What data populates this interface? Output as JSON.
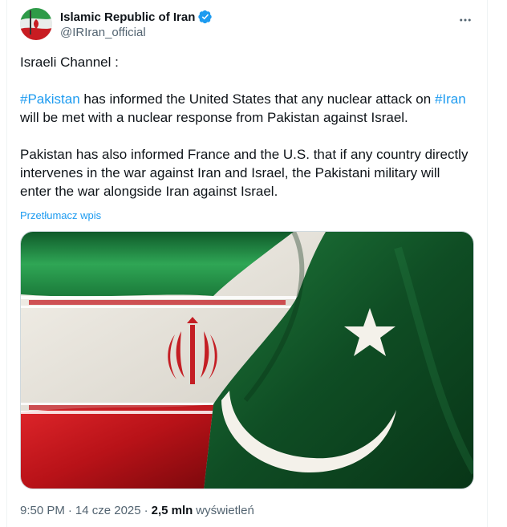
{
  "author": {
    "display_name": "Islamic Republic of Iran",
    "handle": "@IRIran_official"
  },
  "tweet": {
    "line1": "Israeli Channel :",
    "p2_tag1": "#Pakistan",
    "p2_text1": " has informed the United States that any nuclear attack on ",
    "p2_tag2": "#Iran",
    "p2_text2": " will be met with a nuclear response from Pakistan against Israel.",
    "p3": "Pakistan has also informed France and the U.S. that if any country directly intervenes in the war against Iran and Israel, the Pakistani military will enter the war alongside Iran against Israel."
  },
  "translate_label": "Przetłumacz wpis",
  "meta": {
    "time": "9:50 PM",
    "separator": "·",
    "date": "14 cze 2025",
    "views_count": "2,5 mln",
    "views_label": "wyświetleń"
  },
  "icons": {
    "verified": "verified-badge-icon",
    "more": "more-horizontal-icon"
  },
  "colors": {
    "link": "#1d9bf0",
    "text": "#0f1419",
    "secondary": "#536471",
    "iran_green": "#239f40",
    "iran_red": "#da0000",
    "pakistan_green": "#01411c"
  }
}
